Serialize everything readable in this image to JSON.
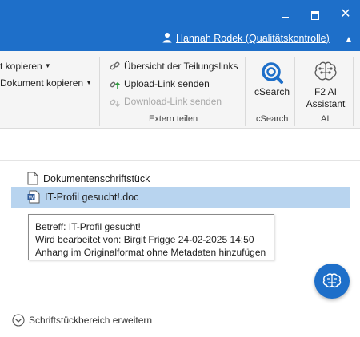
{
  "window": {
    "minimize_glyph": "minimize-icon",
    "maximize_glyph": "maximize-icon",
    "close_glyph": "✕",
    "user_name": "Hannah Rodek (Qualitätskontrolle)",
    "collapse_glyph": "▲"
  },
  "ribbon": {
    "left_items": [
      {
        "label": "t kopieren",
        "has_dropdown": true
      },
      {
        "label": "Dokument kopieren",
        "has_dropdown": true
      }
    ],
    "extern_teilen": {
      "items": [
        {
          "label": "Übersicht der Teilungslinks",
          "icon": "link-overview-icon",
          "enabled": true
        },
        {
          "label": "Upload-Link senden",
          "icon": "upload-link-icon",
          "enabled": true
        },
        {
          "label": "Download-Link senden",
          "icon": "download-link-icon",
          "enabled": false
        }
      ],
      "group_label": "Extern teilen"
    },
    "csearch": {
      "button_label": "cSearch",
      "group_label": "cSearch"
    },
    "ai": {
      "button_label_line1": "F2 AI",
      "button_label_line2": "Assistant",
      "group_label": "AI"
    }
  },
  "documents": [
    {
      "name": "Dokumentenschriftstück",
      "icon": "document-icon",
      "selected": false
    },
    {
      "name": "IT-Profil gesucht!.doc",
      "icon": "word-doc-icon",
      "selected": true
    }
  ],
  "tooltip": {
    "line1": "Betreff: IT-Profil gesucht!",
    "line2": "Wird bearbeitet von: Birgit Frigge 24-02-2025 14:50",
    "line3": "Anhang im Originalformat ohne Metadaten hinzufügen"
  },
  "expand_label": "Schriftstückbereich erweitern",
  "colors": {
    "accent": "#1e6fc9",
    "selection": "#b8d4ef"
  }
}
